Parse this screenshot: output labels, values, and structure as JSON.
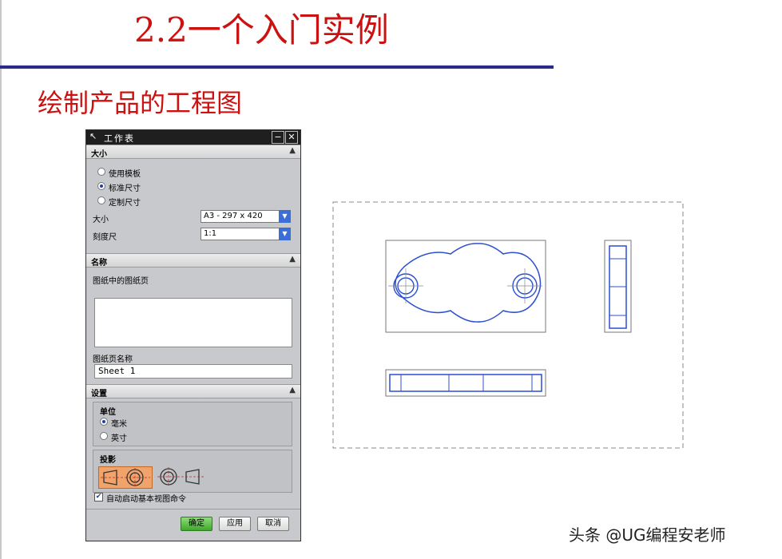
{
  "slide": {
    "title": "2.2一个入门实例",
    "heading": "绘制产品的工程图"
  },
  "dialog": {
    "title": "工作表",
    "size_group": {
      "header": "大小",
      "options": [
        "使用模板",
        "标准尺寸",
        "定制尺寸"
      ],
      "selected_option": "标准尺寸",
      "size_label": "大小",
      "size_value": "A3 - 297 x 420",
      "scale_label": "刻度尺",
      "scale_value": "1:1"
    },
    "name_group": {
      "header": "名称",
      "list_label": "图纸中的图纸页",
      "sheet_name_label": "图纸页名称",
      "sheet_name_value": "Sheet 1"
    },
    "settings_group": {
      "header": "设置",
      "units_title": "单位",
      "units": [
        "毫米",
        "英寸"
      ],
      "selected_unit": "毫米",
      "projection_title": "投影",
      "auto_start_label": "自动启动基本视图命令",
      "auto_start_checked": true
    },
    "buttons": {
      "ok": "确定",
      "apply": "应用",
      "cancel": "取消"
    }
  },
  "watermark": "头条 @UG编程安老师",
  "colors": {
    "title_red": "#cc1111",
    "rule_blue": "#2b2b8c",
    "model_blue": "#2a4fd0",
    "accent_orange": "#f0a36a",
    "ok_green": "#3ea82c"
  }
}
